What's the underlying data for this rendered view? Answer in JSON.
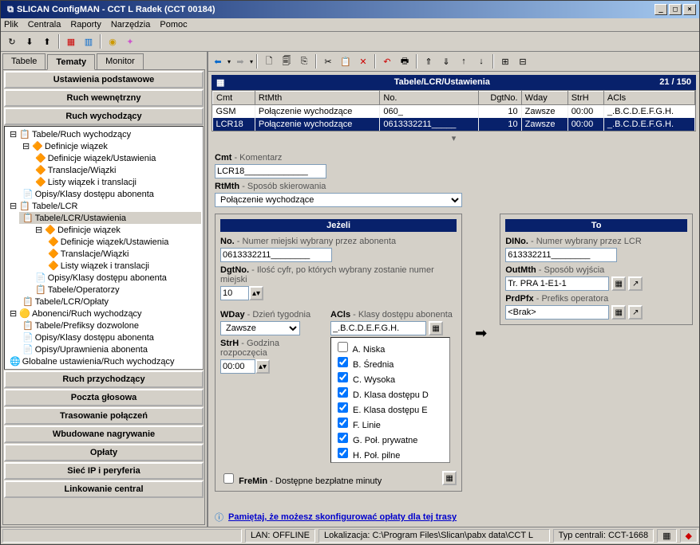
{
  "window": {
    "title": "SLICAN ConfigMAN - CCT L Radek (CCT 00184)"
  },
  "menu": {
    "items": [
      "Plik",
      "Centrala",
      "Raporty",
      "Narzędzia",
      "Pomoc"
    ]
  },
  "left_tabs": {
    "items": [
      "Tabele",
      "Tematy",
      "Monitor"
    ],
    "active": 1
  },
  "accordion": {
    "sections": [
      "Ustawienia podstawowe",
      "Ruch wewnętrzny",
      "Ruch wychodzący",
      "Ruch przychodzący",
      "Poczta głosowa",
      "Trasowanie połączeń",
      "Wbudowane nagrywanie",
      "Opłaty",
      "Sieć IP i peryferia",
      "Linkowanie central"
    ]
  },
  "tree": {
    "n0": "Tabele/Ruch wychodzący",
    "n1": "Definicje wiązek",
    "n2": "Definicje wiązek/Ustawienia",
    "n3": "Translacje/Wiązki",
    "n4": "Listy wiązek i translacji",
    "n5": "Opisy/Klasy dostępu abonenta",
    "n6": "Tabele/LCR",
    "n7": "Tabele/LCR/Ustawienia",
    "n8": "Definicje wiązek",
    "n9": "Definicje wiązek/Ustawienia",
    "n10": "Translacje/Wiązki",
    "n11": "Listy wiązek i translacji",
    "n12": "Opisy/Klasy dostępu abonenta",
    "n13": "Tabele/Operatorzy",
    "n14": "Tabele/LCR/Opłaty",
    "n15": "Abonenci/Ruch wychodzący",
    "n16": "Tabele/Prefiksy dozwolone",
    "n17": "Opisy/Klasy dostępu abonenta",
    "n18": "Opisy/Uprawnienia abonenta",
    "n19": "Globalne ustawienia/Ruch wychodzący"
  },
  "table": {
    "title": "Tabele/LCR/Ustawienia",
    "count": "21 / 150",
    "cols": [
      "Cmt",
      "RtMth",
      "No.",
      "DgtNo.",
      "Wday",
      "StrH",
      "ACls"
    ],
    "rows": [
      {
        "cmt": "GSM",
        "rtmth": "Połączenie wychodzące",
        "no": "060_",
        "dgtno": "10",
        "wday": "Zawsze",
        "strh": "00:00",
        "acls": "_.B.C.D.E.F.G.H."
      },
      {
        "cmt": "LCR18",
        "rtmth": "Połączenie wychodzące",
        "no": "0613332211_____",
        "dgtno": "10",
        "wday": "Zawsze",
        "strh": "00:00",
        "acls": "_.B.C.D.E.F.G.H."
      }
    ]
  },
  "form": {
    "cmt_label": "Cmt",
    "cmt_desc": " - Komentarz",
    "cmt_val": "LCR18_____________",
    "rtmth_label": "RtMth",
    "rtmth_desc": " - Sposób skierowania",
    "rtmth_val": "Połączenie wychodzące",
    "jezeli": "Jeżeli",
    "to": "To",
    "no_label": "No.",
    "no_desc": " - Numer miejski wybrany przez abonenta",
    "no_val": "0613332211________",
    "dgtno_label": "DgtNo.",
    "dgtno_desc": " - Ilość cyfr, po których wybrany zostanie numer miejski",
    "dgtno_val": "10",
    "wday_label": "WDay",
    "wday_desc": " - Dzień tygodnia",
    "wday_val": "Zawsze",
    "strh_label": "StrH",
    "strh_desc": " - Godzina rozpoczęcia",
    "strh_val": "00:00",
    "acls_label": "ACls",
    "acls_desc": " - Klasy dostępu abonenta",
    "acls_val": "_.B.C.D.E.F.G.H.",
    "acls_items": [
      {
        "label": "A. Niska",
        "checked": false
      },
      {
        "label": "B. Średnia",
        "checked": true
      },
      {
        "label": "C. Wysoka",
        "checked": true
      },
      {
        "label": "D. Klasa dostępu D",
        "checked": true
      },
      {
        "label": "E. Klasa dostępu E",
        "checked": true
      },
      {
        "label": "F. Linie",
        "checked": true
      },
      {
        "label": "G. Poł. prywatne",
        "checked": true
      },
      {
        "label": "H. Poł. pilne",
        "checked": true
      }
    ],
    "fremin_label": "FreMin",
    "fremin_desc": " - Dostępne bezpłatne minuty",
    "dino_label": "DINo.",
    "dino_desc": " - Numer wybrany przez LCR",
    "dino_val": "613332211________",
    "outmth_label": "OutMth",
    "outmth_desc": " - Sposób wyjścia",
    "outmth_val": "Tr. PRA 1-E1-1",
    "prdpfx_label": "PrdPfx",
    "prdpfx_desc": " - Prefiks operatora",
    "prdpfx_val": "<Brak>"
  },
  "hint": {
    "text": "Pamiętaj, że możesz skonfigurować opłaty dla tej trasy"
  },
  "status": {
    "lan": "LAN: OFFLINE",
    "loc": "Lokalizacja: C:\\Program Files\\Slican\\pabx data\\CCT L",
    "typ": "Typ centrali: CCT-1668"
  }
}
